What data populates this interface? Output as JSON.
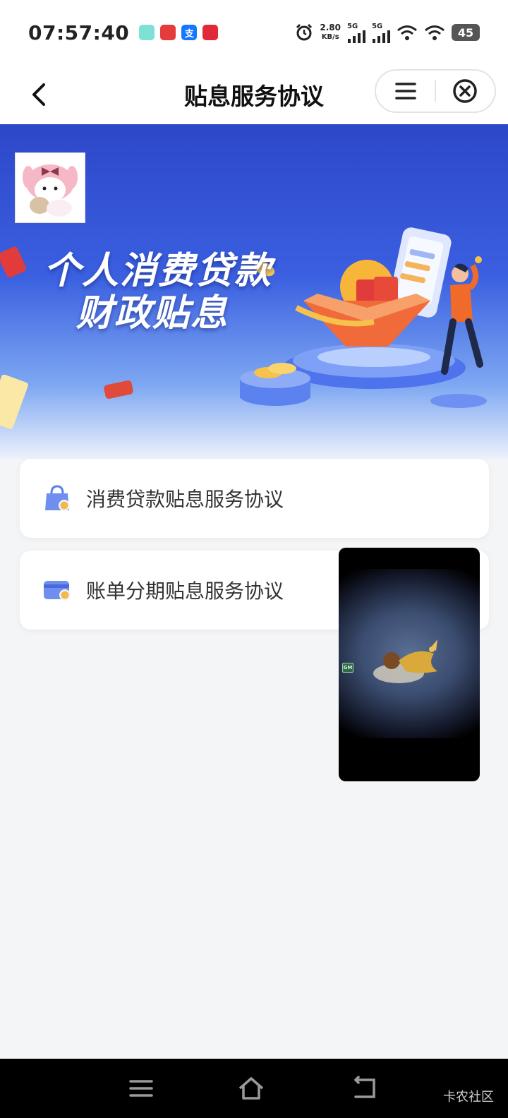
{
  "status_bar": {
    "time": "07:57:40",
    "net_speed_value": "2.80",
    "net_speed_unit": "KB/s",
    "signal_1": "5G",
    "signal_2": "5G",
    "battery": "45"
  },
  "nav": {
    "title": "贴息服务协议"
  },
  "banner": {
    "line1": "个人消费贷款",
    "line2": "财政贴息"
  },
  "cards": [
    {
      "label": "消费贷款贴息服务协议",
      "icon": "bag-icon"
    },
    {
      "label": "账单分期贴息服务协议",
      "icon": "card-icon"
    }
  ],
  "float_video": {
    "badge": "GM"
  },
  "watermark": "卡农社区",
  "colors": {
    "banner_top": "#2e47c9",
    "banner_mid": "#3a5fe0",
    "card_icon": "#5b7fe8",
    "card_icon_coin": "#f2b84b"
  }
}
